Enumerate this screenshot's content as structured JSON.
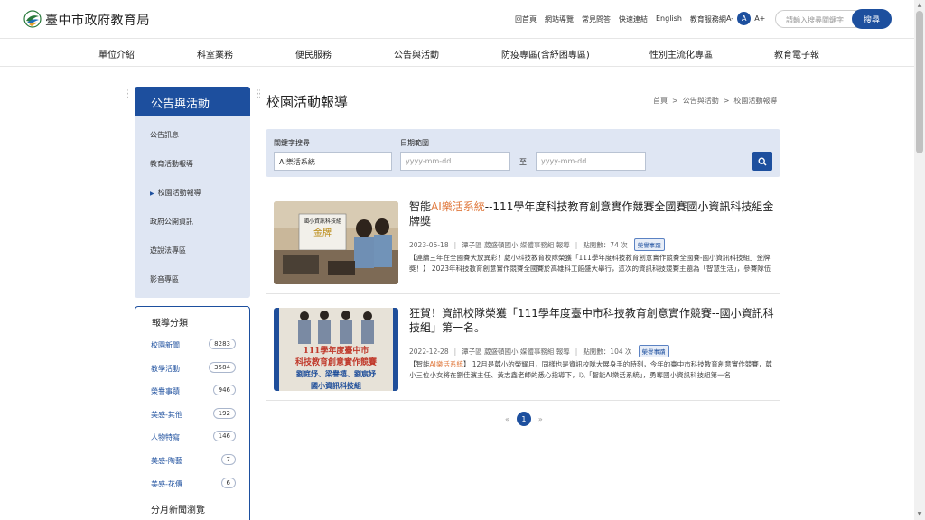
{
  "header": {
    "site_title": "臺中市政府教育局",
    "util_links": [
      "回首頁",
      "網站導覽",
      "常見問答",
      "快速連結",
      "English",
      "教育服務網"
    ],
    "font_small": "A-",
    "font_mid": "A",
    "font_large": "A+",
    "search_placeholder": "請輸入搜尋關鍵字",
    "search_button": "搜尋"
  },
  "main_nav": [
    "單位介紹",
    "科室業務",
    "便民服務",
    "公告與活動",
    "防疫專區(含紓困專區)",
    "性別主流化專區",
    "教育電子報"
  ],
  "sidebar": {
    "title": "公告與活動",
    "items": [
      {
        "label": "公告訊息",
        "active": false
      },
      {
        "label": "教育活動報導",
        "active": false
      },
      {
        "label": "校園活動報導",
        "active": true
      },
      {
        "label": "政府公開資訊",
        "active": false
      },
      {
        "label": "遊說法專區",
        "active": false
      },
      {
        "label": "影音專區",
        "active": false
      }
    ],
    "active_marker": "▶"
  },
  "categories": {
    "title": "報導分類",
    "items": [
      {
        "label": "校園新聞",
        "count": "8283"
      },
      {
        "label": "教學活動",
        "count": "3584"
      },
      {
        "label": "榮譽事蹟",
        "count": "946"
      },
      {
        "label": "美感-其他",
        "count": "192"
      },
      {
        "label": "人物特寫",
        "count": "146"
      },
      {
        "label": "美感-陶藝",
        "count": "7"
      },
      {
        "label": "美感-花傳",
        "count": "6"
      }
    ],
    "month_title": "分月新聞瀏覽"
  },
  "content": {
    "title": "校園活動報導",
    "breadcrumb": [
      "首頁",
      "公告與活動",
      "校園活動報導"
    ],
    "breadcrumb_sep": ">"
  },
  "filter": {
    "keyword_label": "關鍵字搜尋",
    "keyword_value": "AI樂活系統",
    "date_label": "日期範圍",
    "date_from_placeholder": "yyyy-mm-dd",
    "date_to_placeholder": "yyyy-mm-dd",
    "range_sep": "至"
  },
  "articles": [
    {
      "title_pre": "智能",
      "title_hl": "AI樂活系統",
      "title_post": "--111學年度科技教育創意實作競賽全國賽國小資訊科技組金牌獎",
      "date": "2023-05-18",
      "author": "潭子區 葳盛頓國小 媒體事務組 報導",
      "views": "點閱數：74 次",
      "tag": "榮譽事蹟",
      "summary_pre": "【連續三年在全國賽大放異彩！葳小科技教育校隊榮獲「111學年度科技教育創意實作競賽全國賽-國小資訊科技組」金牌獎！】 2023年科技教育創意實作競賽全國賽於高雄科工館盛大舉行，這次的資訊科技競賽主題為「智慧生活」，參賽隊伍須在限時內完成作品",
      "summary_hl": "",
      "summary_post": "",
      "thumb_caption": "國小資訊科技組 金牌"
    },
    {
      "title_pre": "狂賀！資訊校隊榮獲「111學年度臺中市科技教育創意實作競賽--國小資訊科技組」第一名。",
      "title_hl": "",
      "title_post": "",
      "date": "2022-12-28",
      "author": "潭子區 葳盛頓國小 媒體事務組 報導",
      "views": "點閱數：104 次",
      "tag": "榮譽事蹟",
      "summary_pre": "【智能",
      "summary_hl": "AI樂活系統",
      "summary_post": "】 12月是葳小的榮耀月，同樣也是資訊校隊大展身手的時刻，今年的臺中市科技教育創意實作競賽，葳小三位小女將在劉佳濱主任、黃志鑫老師的悉心指導下，以「智能AI樂活系統」，勇奪國小資訊科技組第一名",
      "thumb_line1": "111學年度臺中市",
      "thumb_line2": "科技教育創意實作競賽",
      "thumb_line3": "劉庭妤、梁譽禧、劉宸妤",
      "thumb_line4": "國小資訊科技組"
    }
  ],
  "pager": {
    "prev": "«",
    "current": "1",
    "next": "»"
  },
  "scrollbar": {
    "up": "▲",
    "down": "▼"
  },
  "colors": {
    "primary": "#1d4f9e",
    "panel": "#dfe6f3",
    "highlight": "#e07a3f"
  }
}
